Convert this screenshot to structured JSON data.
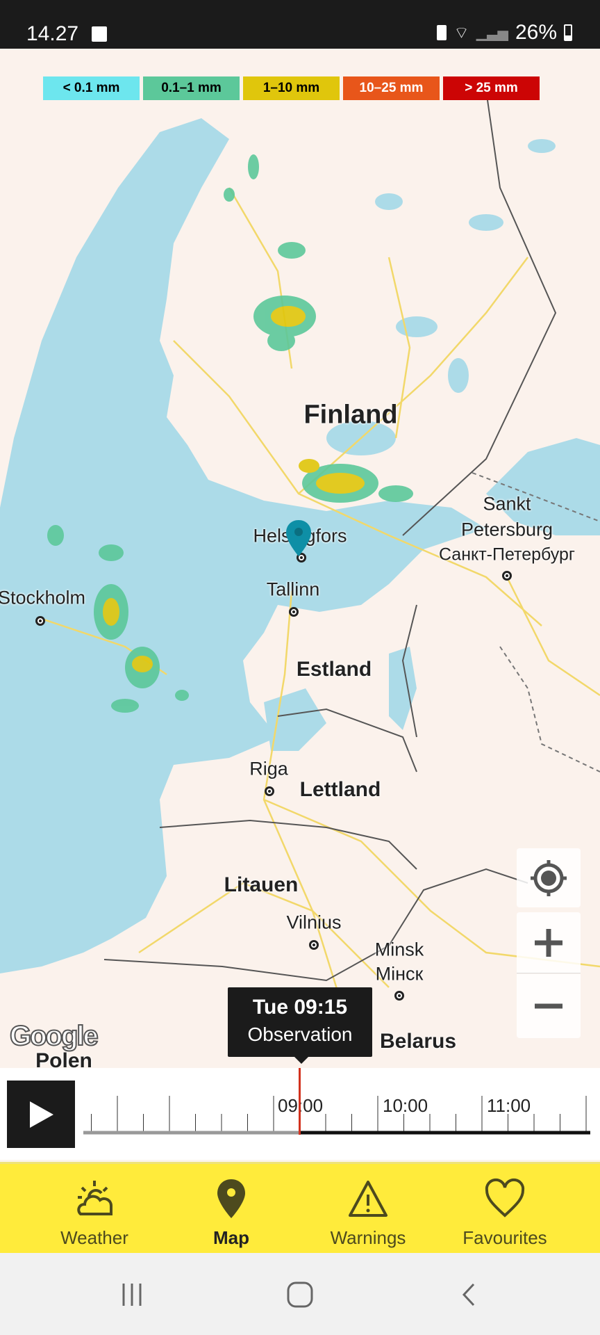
{
  "status_bar": {
    "time": "14.27",
    "battery": "26%",
    "icons": [
      "gallery-icon",
      "battery-saver-icon",
      "wifi-icon",
      "signal-icon",
      "battery-icon"
    ]
  },
  "legend": [
    {
      "label": "< 0.1 mm",
      "color": "#6de6ee",
      "text_color": "#000"
    },
    {
      "label": "0.1–1 mm",
      "color": "#5cc89a",
      "text_color": "#000"
    },
    {
      "label": "1–10 mm",
      "color": "#e0c60c",
      "text_color": "#000"
    },
    {
      "label": "10–25 mm",
      "color": "#e8561a",
      "text_color": "#fff"
    },
    {
      "label": "> 25 mm",
      "color": "#cc0505",
      "text_color": "#fff"
    }
  ],
  "map": {
    "countries": {
      "finland": "Finland",
      "estonia": "Estland",
      "latvia": "Lettland",
      "lithuania": "Litauen",
      "belarus": "Belarus",
      "poland": "Polen"
    },
    "cities": {
      "helsinki": "Helsingfors",
      "tallinn": "Tallinn",
      "stockholm": "Stockholm",
      "riga": "Riga",
      "vilnius": "Vilnius",
      "minsk": "Minsk",
      "minsk_local": "Мінск",
      "spb1": "Sankt",
      "spb2": "Petersburg",
      "spb_local": "Санкт-Петербург"
    },
    "attribution": "Google",
    "marker_color": "#0e8fa6"
  },
  "tooltip": {
    "time": "Tue 09:15",
    "type": "Observation"
  },
  "timeline": {
    "hours": [
      "09:00",
      "10:00",
      "11:00"
    ],
    "current": "09:15",
    "indicator_color": "#d2321e"
  },
  "nav": {
    "items": [
      {
        "label": "Weather"
      },
      {
        "label": "Map",
        "active": true
      },
      {
        "label": "Warnings"
      },
      {
        "label": "Favourites"
      }
    ],
    "bg": "#ffeb3b"
  }
}
